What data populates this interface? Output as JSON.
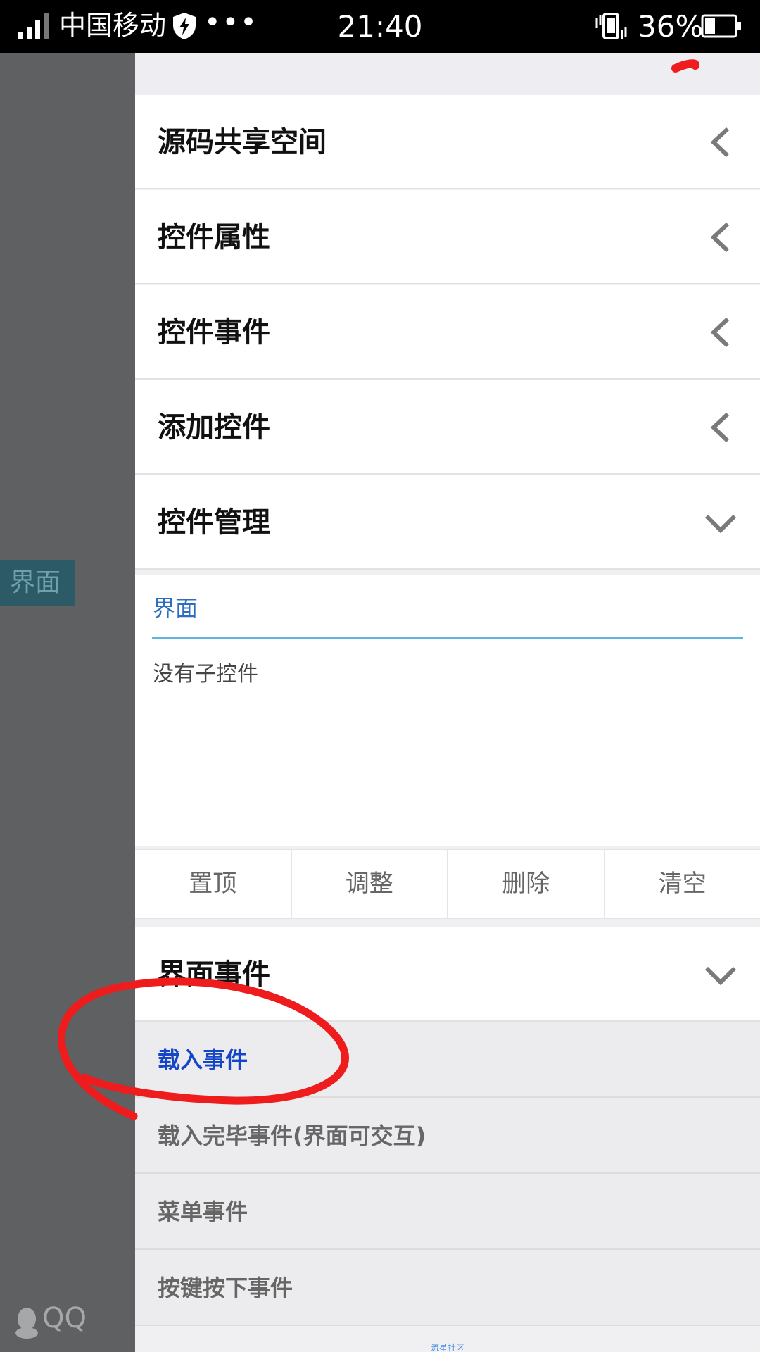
{
  "status_bar": {
    "carrier": "中国移动",
    "more": "•••",
    "time": "21:40",
    "battery_percent": "36%",
    "battery_level": 0.36
  },
  "left_panel": {
    "screen_tag": "界面",
    "qq_label": "QQ"
  },
  "drawer": {
    "sections": [
      {
        "label": "源码共享空间",
        "icon": "chevron-left-icon"
      },
      {
        "label": "控件属性",
        "icon": "chevron-left-icon"
      },
      {
        "label": "控件事件",
        "icon": "chevron-left-icon"
      },
      {
        "label": "添加控件",
        "icon": "chevron-left-icon"
      },
      {
        "label": "控件管理",
        "icon": "chevron-down-icon"
      }
    ],
    "control_tree": {
      "tab": "界面",
      "empty_text": "没有子控件"
    },
    "actions": [
      "置顶",
      "调整",
      "删除",
      "清空"
    ],
    "events_header": {
      "label": "界面事件",
      "icon": "chevron-down-icon"
    },
    "events": [
      "载入事件",
      "载入完毕事件(界面可交互)",
      "菜单事件",
      "按键按下事件"
    ],
    "footer": "流星社区"
  },
  "colors": {
    "accent_blue": "#1546c8",
    "tab_underline": "#5fb4e0",
    "annotation_red": "#ee1c1c"
  }
}
